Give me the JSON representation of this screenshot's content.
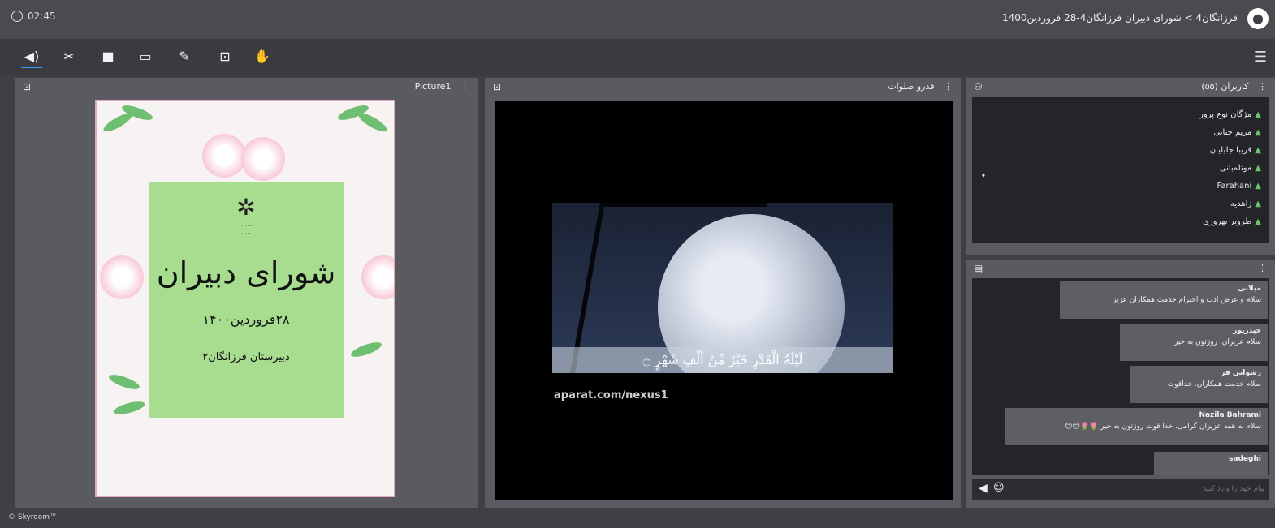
{
  "topbar": {
    "timer": "02:45",
    "breadcrumb": "فرزانگان4 > شورای دبیران فرزانگان4-28 فروردین1400"
  },
  "toolbar": {
    "buttons": [
      {
        "name": "speaker-icon",
        "glyph": "🔊"
      },
      {
        "name": "mic-muted-icon",
        "glyph": "🎙"
      },
      {
        "name": "camera-icon",
        "glyph": "■"
      },
      {
        "name": "screen-share-icon",
        "glyph": "▭"
      },
      {
        "name": "pen-icon",
        "glyph": "✎"
      },
      {
        "name": "play-box-icon",
        "glyph": "▶"
      },
      {
        "name": "raise-hand-icon",
        "glyph": "✋"
      }
    ]
  },
  "picture_panel": {
    "title": "Picture1",
    "poster": {
      "title": "شورای دبیران",
      "date": "۲۸فروردین۱۴۰۰",
      "school": "دبیرستان فرزانگان۲"
    }
  },
  "video_panel": {
    "title": "قدرو صلوات",
    "verse": "لَيْلَةُ الْقَدْرِ خَيْرٌ مِّنْ أَلْفِ شَهْرٍ ۝",
    "watermark": "aparat.com/nexus1"
  },
  "users_panel": {
    "title": "کاربران (۵۵)",
    "users": [
      "مژگان نوع پرور",
      "مریم جنانی",
      "فریبا جلیلیان",
      "موتلمبانی",
      "Farahani",
      "زاهدیه",
      "طروبر بهروزی"
    ]
  },
  "chat_panel": {
    "messages": [
      {
        "name": "میلانی",
        "text": "سلام و عرض ادب و احترام خدمت همکاران عزیز"
      },
      {
        "name": "حیدرپور",
        "text": "سلام عزیزان، روزتون به خیر"
      },
      {
        "name": "رشوانی فر",
        "text": "سلام خدمت همکاران. خداقوت"
      },
      {
        "name": "Nazila Bahrami",
        "text": "سلام به همه عزیزان گرامی، خدا قوت روزتون به خیر 🌷🌷😊😊"
      },
      {
        "name": "sadeghi",
        "text": ""
      }
    ],
    "input_placeholder": "پیام خود را وارد کنید"
  },
  "footer": {
    "copyright": "© Skyroom™"
  },
  "colors": {
    "accent": "#3aa0ff",
    "user_icon": "#6cc36c",
    "poster_card": "#a8dc8f"
  }
}
